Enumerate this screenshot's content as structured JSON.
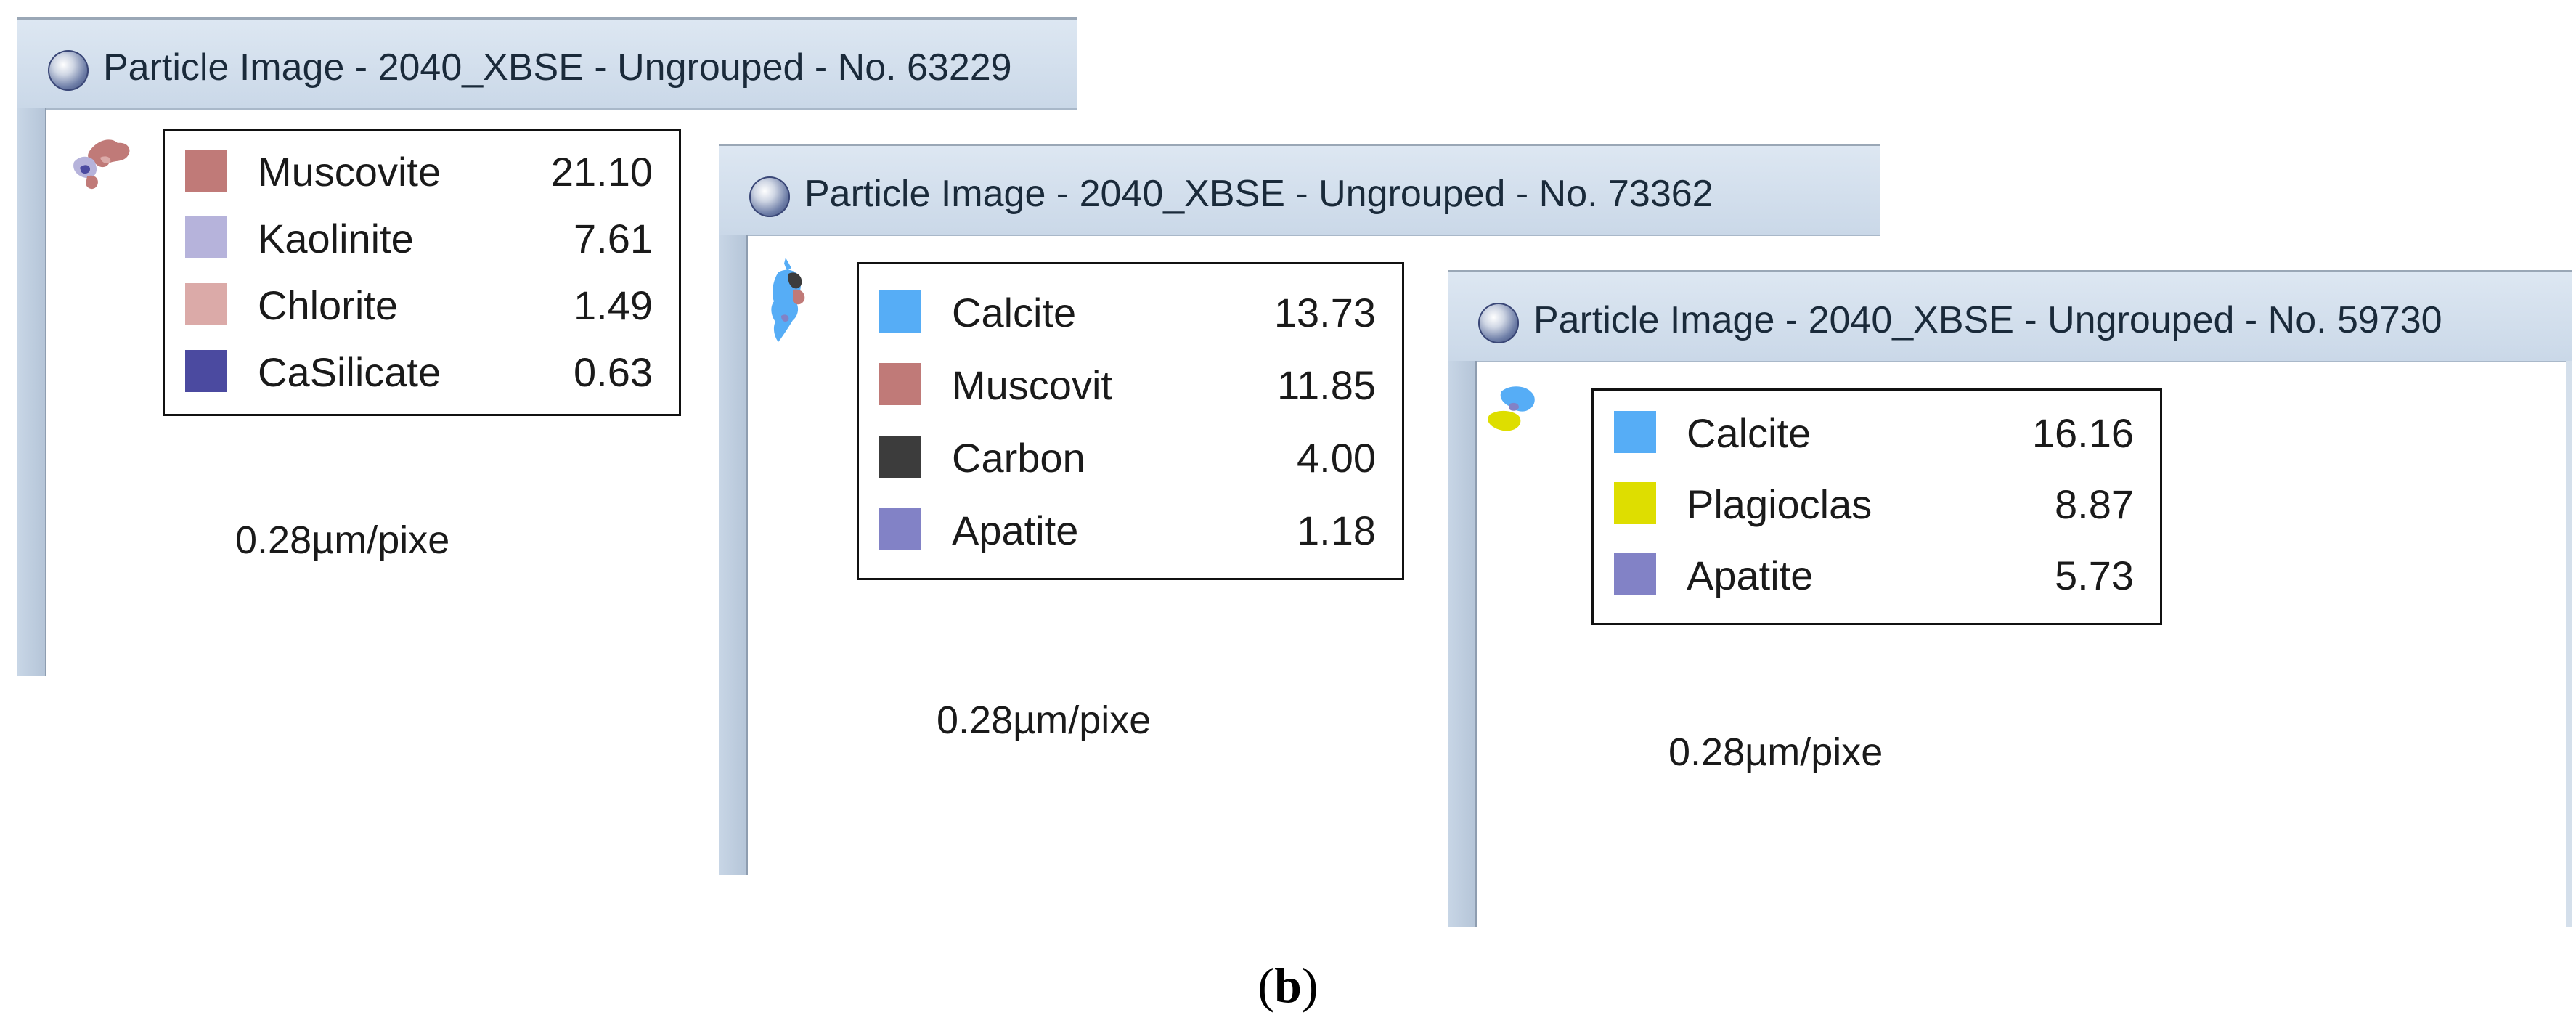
{
  "windows": [
    {
      "title": "Particle Image - 2040_XBSE - Ungrouped - No. 63229",
      "scale_label": "0.28µm/pixe",
      "minerals": [
        {
          "name": "Muscovite",
          "value": "21.10",
          "color": "#c07a78"
        },
        {
          "name": "Kaolinite",
          "value": "7.61",
          "color": "#b6b3db"
        },
        {
          "name": "Chlorite",
          "value": "1.49",
          "color": "#dbaaa8"
        },
        {
          "name": "CaSilicate",
          "value": "0.63",
          "color": "#4b4aa0"
        }
      ]
    },
    {
      "title": "Particle Image - 2040_XBSE - Ungrouped - No. 73362",
      "scale_label": "0.28µm/pixe",
      "minerals": [
        {
          "name": "Calcite",
          "value": "13.73",
          "color": "#56adf6"
        },
        {
          "name": "Muscovit",
          "value": "11.85",
          "color": "#c07a78"
        },
        {
          "name": "Carbon",
          "value": "4.00",
          "color": "#3c3c3c"
        },
        {
          "name": "Apatite",
          "value": "1.18",
          "color": "#8282c6"
        }
      ]
    },
    {
      "title": "Particle Image - 2040_XBSE - Ungrouped - No. 59730",
      "scale_label": "0.28µm/pixe",
      "minerals": [
        {
          "name": "Calcite",
          "value": "16.16",
          "color": "#56adf6"
        },
        {
          "name": "Plagioclas",
          "value": "8.87",
          "color": "#dede00"
        },
        {
          "name": "Apatite",
          "value": "5.73",
          "color": "#8282c6"
        }
      ]
    }
  ],
  "caption": {
    "open": "(",
    "label": "b",
    "close": ")"
  }
}
